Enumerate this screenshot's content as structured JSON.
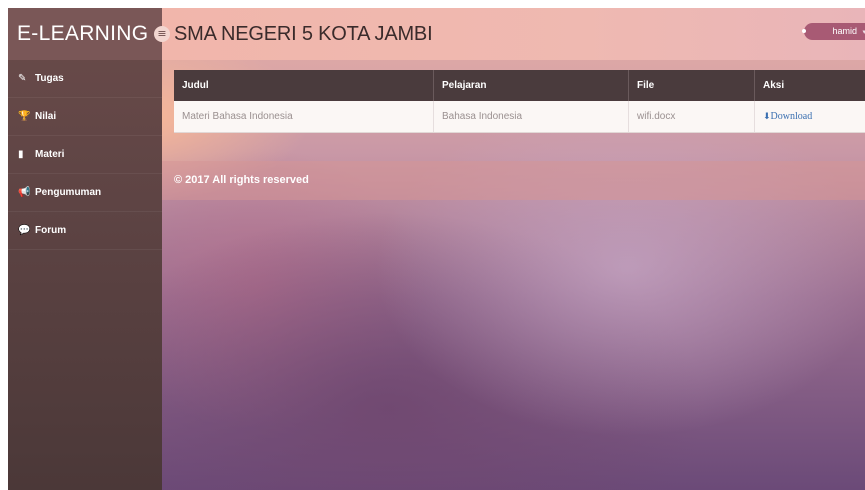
{
  "brand": {
    "title": "E-LEARNING",
    "toggle_icon": "≡"
  },
  "header": {
    "title": "SMA NEGERI 5 KOTA JAMBI",
    "user": "hamid",
    "caret": "▾"
  },
  "sidebar": {
    "items": [
      {
        "label": "Tugas",
        "icon": "✎"
      },
      {
        "label": "Nilai",
        "icon": "🏆"
      },
      {
        "label": "Materi",
        "icon": "▮"
      },
      {
        "label": "Pengumuman",
        "icon": "📢"
      },
      {
        "label": "Forum",
        "icon": "💬"
      }
    ]
  },
  "table": {
    "headers": [
      "Judul",
      "Pelajaran",
      "File",
      "Aksi"
    ],
    "rows": [
      {
        "judul": "Materi Bahasa Indonesia",
        "pelajaran": "Bahasa Indonesia",
        "file": "wifi.docx",
        "aksi": "Download",
        "aksi_icon": "⬇"
      }
    ]
  },
  "footer": {
    "text": "© 2017 All rights reserved"
  },
  "colors": {
    "sidebar": "#5e4444",
    "header": "#f1b6ab",
    "table_header": "#4a3b3d",
    "user_button": "#a85a74",
    "link": "#3a6fb0"
  }
}
